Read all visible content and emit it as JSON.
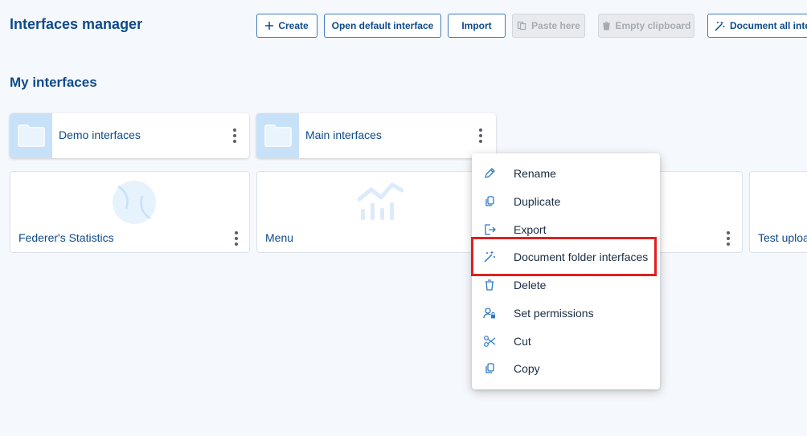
{
  "header": {
    "title": "Interfaces manager"
  },
  "toolbar": {
    "create_label": "Create",
    "open_default_label": "Open default interface",
    "import_label": "Import",
    "paste_label": "Paste here",
    "empty_clipboard_label": "Empty clipboard",
    "document_all_label": "Document all interfaces"
  },
  "section": {
    "title": "My interfaces"
  },
  "folders": [
    {
      "label": "Demo interfaces"
    },
    {
      "label": "Main interfaces"
    }
  ],
  "interfaces": [
    {
      "label": "Federer's Statistics",
      "icon": "tennis-ball-icon"
    },
    {
      "label": "Menu",
      "icon": "chart-icon"
    },
    {
      "label": "",
      "icon": ""
    },
    {
      "label": "Test upload",
      "icon": ""
    }
  ],
  "context_menu": {
    "items": [
      {
        "label": "Rename",
        "icon": "pencil-icon"
      },
      {
        "label": "Duplicate",
        "icon": "duplicate-icon"
      },
      {
        "label": "Export",
        "icon": "export-icon"
      },
      {
        "label": "Document folder interfaces",
        "icon": "magic-wand-icon"
      },
      {
        "label": "Delete",
        "icon": "trash-icon"
      },
      {
        "label": "Set permissions",
        "icon": "user-lock-icon"
      },
      {
        "label": "Cut",
        "icon": "scissors-icon"
      },
      {
        "label": "Copy",
        "icon": "copy-icon"
      }
    ]
  },
  "colors": {
    "primary": "#0d4a8c",
    "folder_bg": "#c7e1f8",
    "highlight": "#e01f1f",
    "background": "#f5f8fc"
  }
}
